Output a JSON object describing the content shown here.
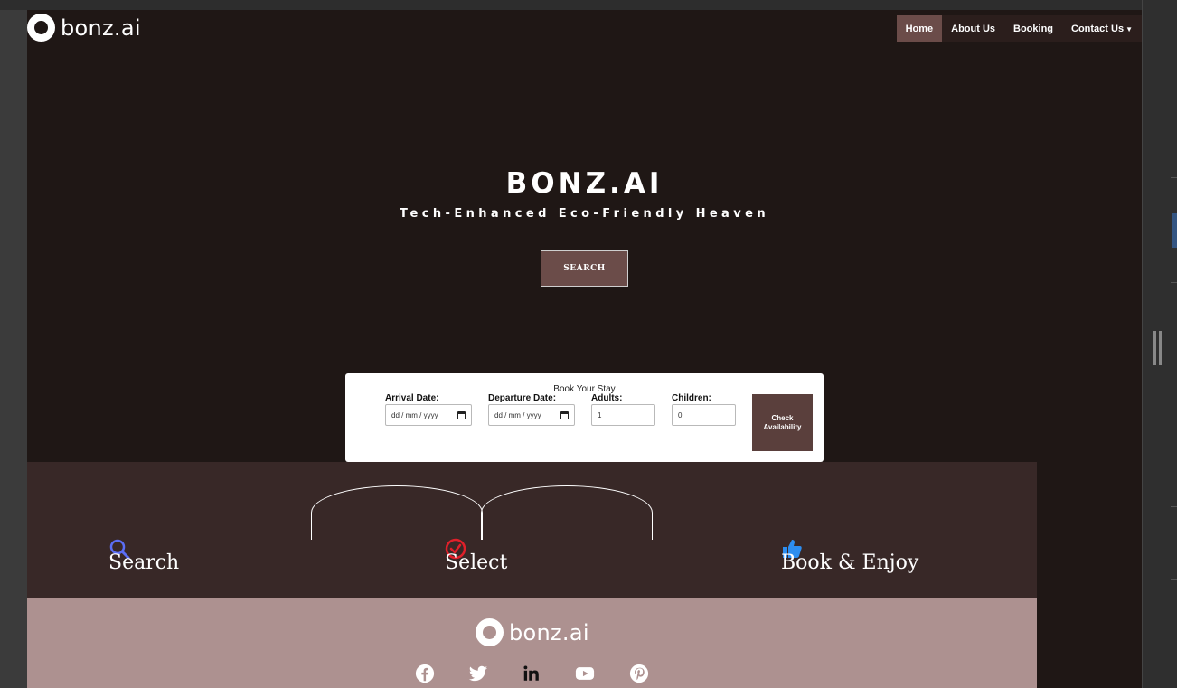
{
  "brand": {
    "name": "bonz.ai"
  },
  "nav": {
    "items": [
      {
        "label": "Home",
        "active": true
      },
      {
        "label": "About Us",
        "active": false
      },
      {
        "label": "Booking",
        "active": false
      },
      {
        "label": "Contact Us",
        "active": false
      }
    ]
  },
  "hero": {
    "title": "BONZ.AI",
    "subtitle": "Tech-Enhanced Eco-Friendly Heaven",
    "button_label": "SEARCH"
  },
  "booking": {
    "title": "Book Your Stay",
    "arrival_label": "Arrival Date:",
    "arrival_value": "dd / mm / yyyy",
    "departure_label": "Departure Date:",
    "departure_value": "dd / mm / yyyy",
    "adults_label": "Adults:",
    "adults_value": "1",
    "children_label": "Children:",
    "children_value": "0",
    "check_button": "Check Availability"
  },
  "steps": [
    {
      "label": "Search",
      "icon": "search-icon",
      "color": "#5b6ef5"
    },
    {
      "label": "Select",
      "icon": "check-circle-icon",
      "color": "#e0202a"
    },
    {
      "label": "Book & Enjoy",
      "icon": "thumbs-up-icon",
      "color": "#2d8ef0"
    }
  ],
  "footer": {
    "brand": "bonz.ai",
    "social": [
      "facebook-icon",
      "twitter-icon",
      "linkedin-icon",
      "youtube-icon",
      "pinterest-icon"
    ]
  },
  "colors": {
    "page_bg": "#1f1715",
    "accent": "#6b4c49",
    "steps_bg": "#382827",
    "footer_bg": "#ad9190"
  }
}
